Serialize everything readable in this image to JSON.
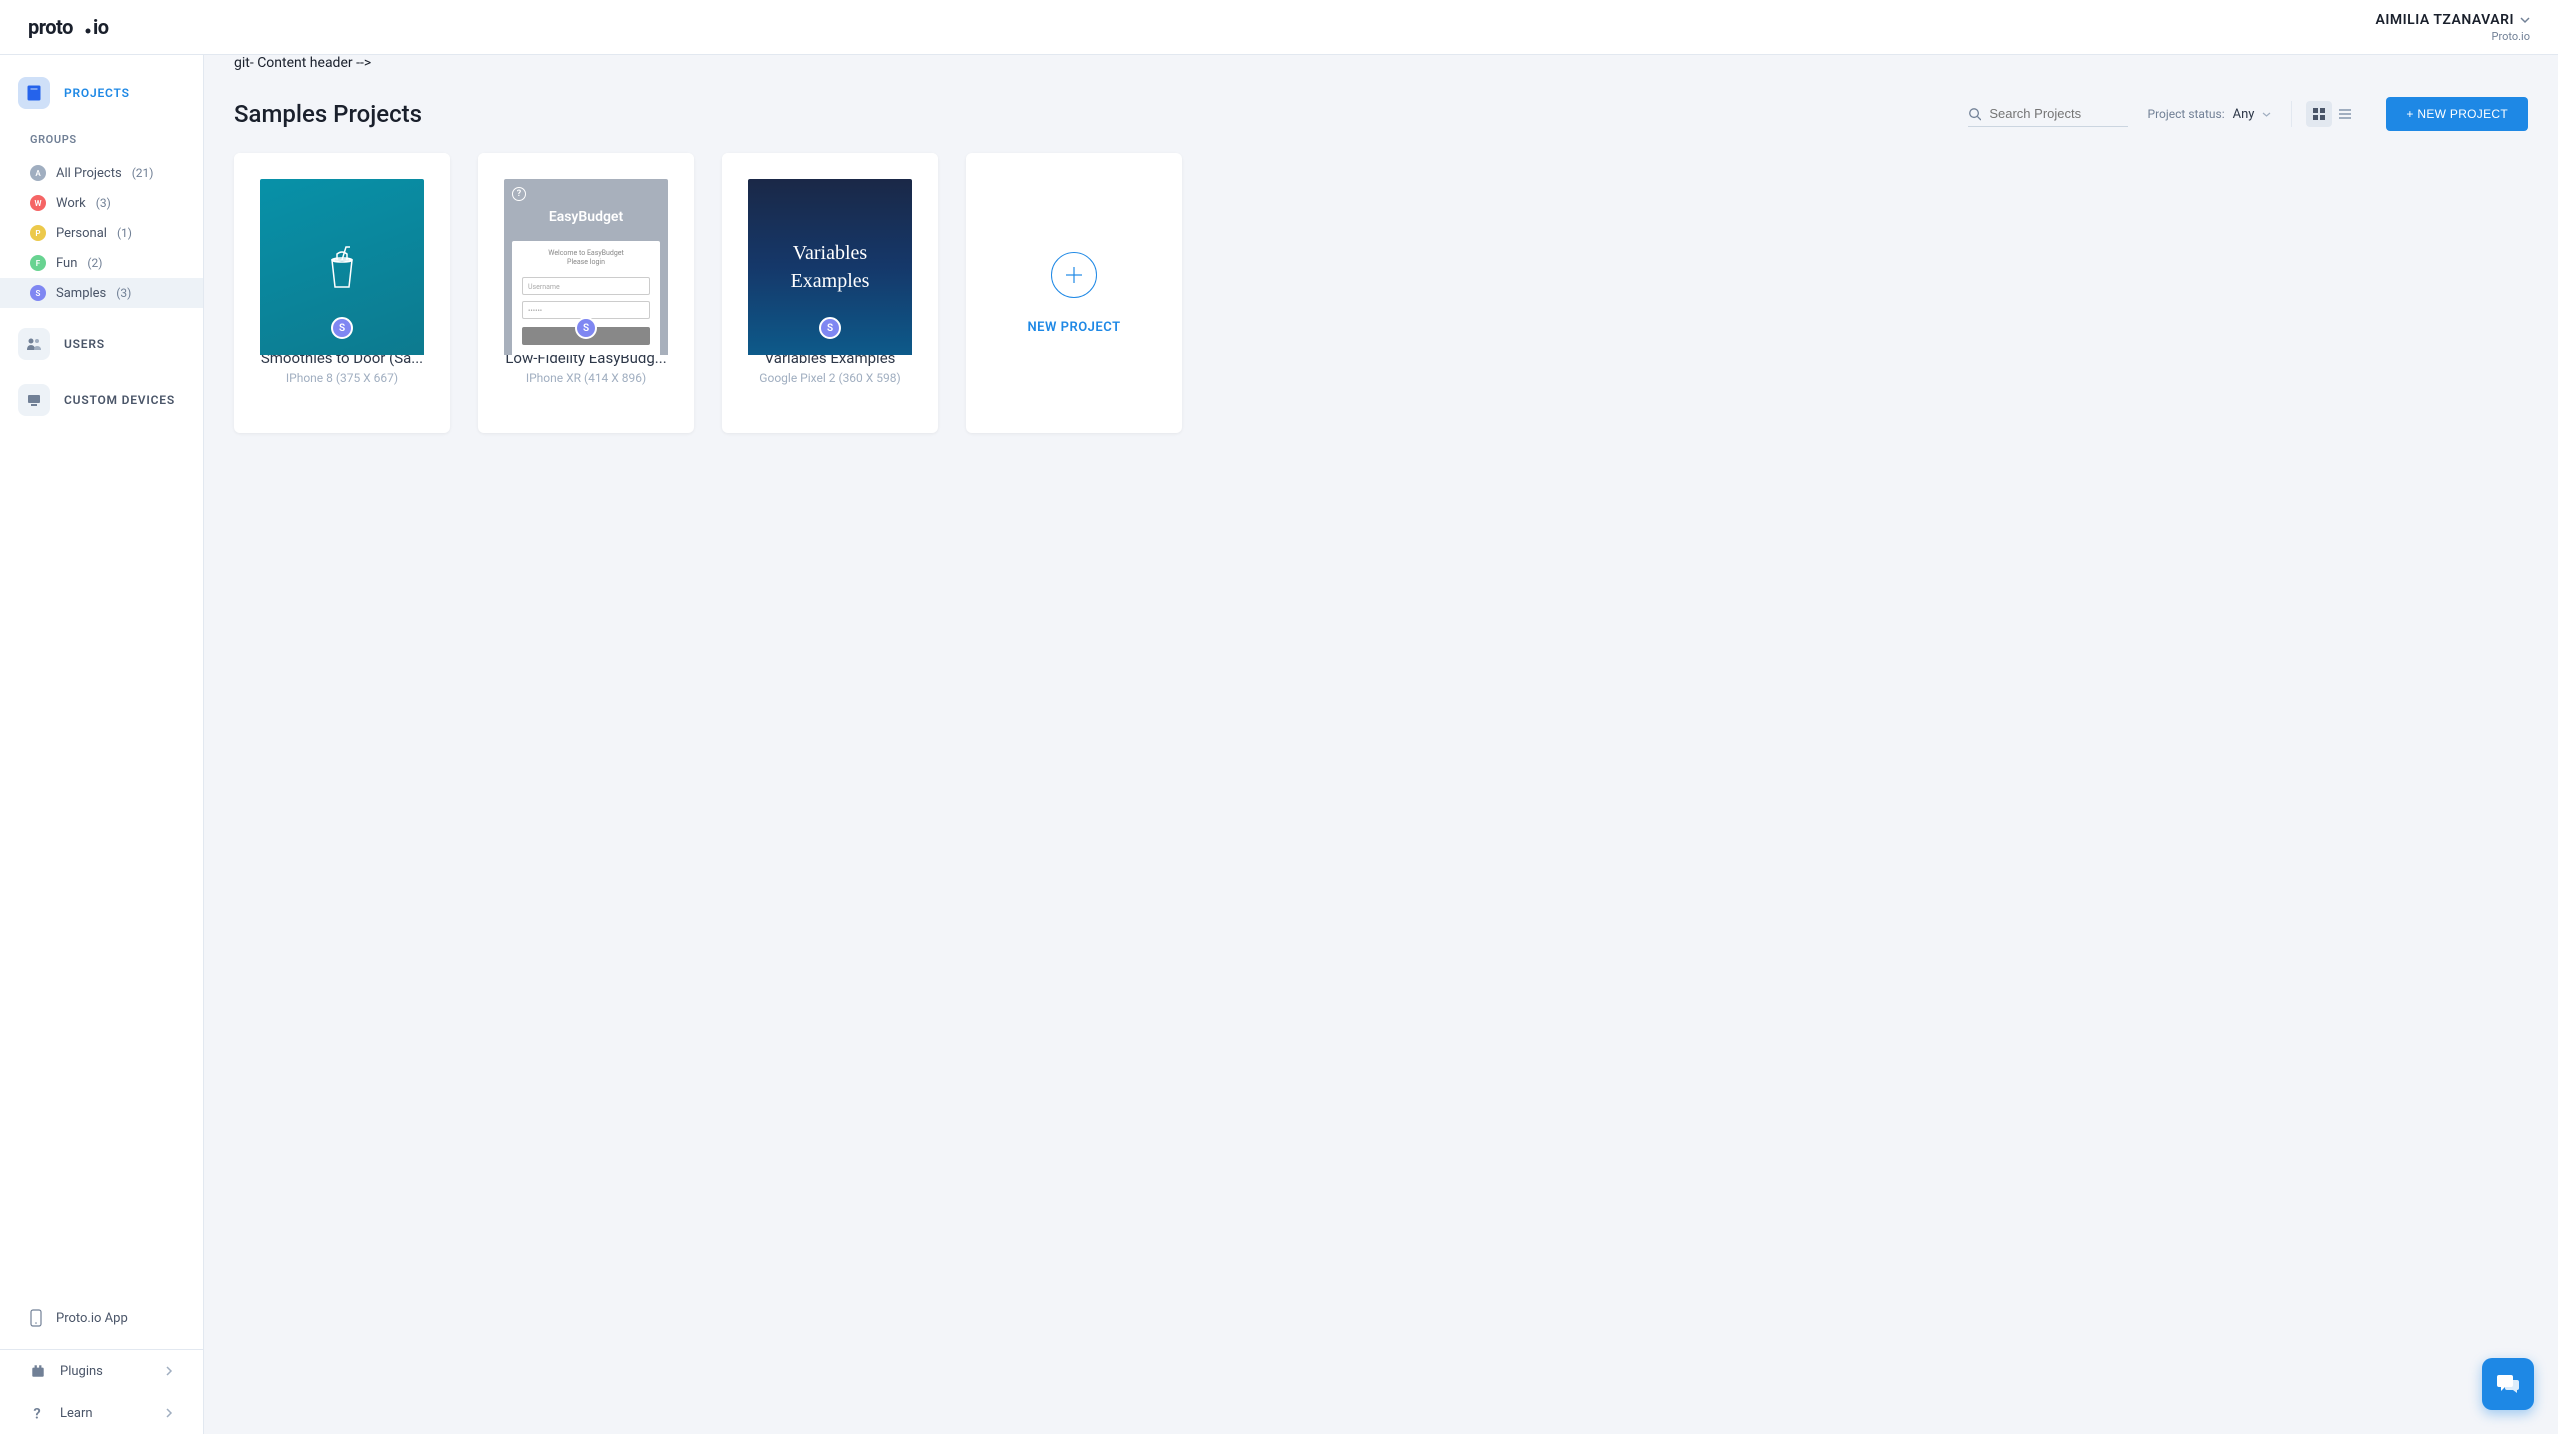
{
  "brand": "proto.io",
  "user": {
    "name": "AIMILIA TZANAVARI",
    "org": "Proto.io"
  },
  "sidebar": {
    "projects_label": "PROJECTS",
    "groups_heading": "GROUPS",
    "users_label": "USERS",
    "custom_devices_label": "CUSTOM DEVICES",
    "groups": [
      {
        "letter": "A",
        "name": "All Projects",
        "count": "(21)",
        "color": "#a0aec0"
      },
      {
        "letter": "W",
        "name": "Work",
        "count": "(3)",
        "color": "#f56565"
      },
      {
        "letter": "P",
        "name": "Personal",
        "count": "(1)",
        "color": "#ecc94b"
      },
      {
        "letter": "F",
        "name": "Fun",
        "count": "(2)",
        "color": "#68d391"
      },
      {
        "letter": "S",
        "name": "Samples",
        "count": "(3)",
        "color": "#7f87f2"
      }
    ],
    "proto_app": "Proto.io App",
    "plugins": "Plugins",
    "learn": "Learn"
  },
  "page": {
    "title": "Samples Projects",
    "search_placeholder": "Search Projects",
    "status_label": "Project status:",
    "status_value": "Any",
    "new_project_btn": "+ NEW PROJECT",
    "new_card_label": "NEW PROJECT"
  },
  "projects": [
    {
      "title": "Smoothies to Door (Sa...",
      "device": "IPhone 8 (375 X 667)",
      "badge_letter": "S",
      "badge_color": "#7f87f2"
    },
    {
      "title": "Low-Fidelity EasyBudg...",
      "device": "IPhone XR (414 X 896)",
      "badge_letter": "S",
      "badge_color": "#7f87f2"
    },
    {
      "title": "Variables Examples",
      "device": "Google Pixel 2 (360 X 598)",
      "badge_letter": "S",
      "badge_color": "#7f87f2"
    }
  ],
  "thumbs": {
    "easybudget": {
      "title": "EasyBudget",
      "welcome": "Welcome to EasyBudget\nPlease login",
      "username": "Username"
    },
    "vars": "Variables\nExamples"
  }
}
